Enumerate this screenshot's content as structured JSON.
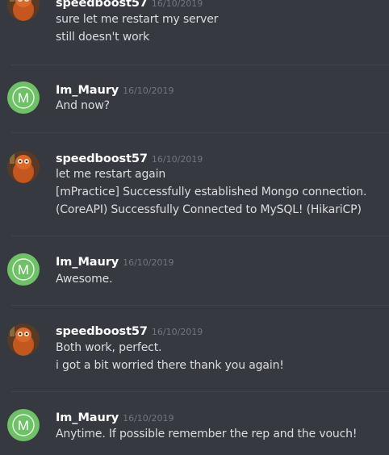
{
  "messages": [
    {
      "author": "speedboost57",
      "timestamp": "16/10/2019",
      "avatar": "orange-character-avatar",
      "lines": [
        "sure let me restart my server",
        "still doesn't work"
      ]
    },
    {
      "author": "Im_Maury",
      "timestamp": "16/10/2019",
      "avatar": "green-letter-m-avatar",
      "lines": [
        "And now?"
      ]
    },
    {
      "author": "speedboost57",
      "timestamp": "16/10/2019",
      "avatar": "orange-character-avatar",
      "lines": [
        "let me restart again",
        "[mPractice] Successfully established Mongo connection.",
        "(CoreAPI) Successfully Connected to MySQL! (HikariCP)"
      ]
    },
    {
      "author": "Im_Maury",
      "timestamp": "16/10/2019",
      "avatar": "green-letter-m-avatar",
      "lines": [
        "Awesome."
      ]
    },
    {
      "author": "speedboost57",
      "timestamp": "16/10/2019",
      "avatar": "orange-character-avatar",
      "lines": [
        "Both work, perfect.",
        "i got a bit worried there thank you again!"
      ]
    },
    {
      "author": "Im_Maury",
      "timestamp": "16/10/2019",
      "avatar": "green-letter-m-avatar",
      "lines": [
        "Anytime. If possible remember the rep and the vouch!"
      ]
    }
  ],
  "avatar_letter": "M",
  "colors": {
    "background": "#36393f",
    "username": "#ffffff",
    "timestamp": "#72767d",
    "message_text": "#dcddde",
    "green_avatar": "#6fc167",
    "orange_avatar": "#c4571f"
  }
}
